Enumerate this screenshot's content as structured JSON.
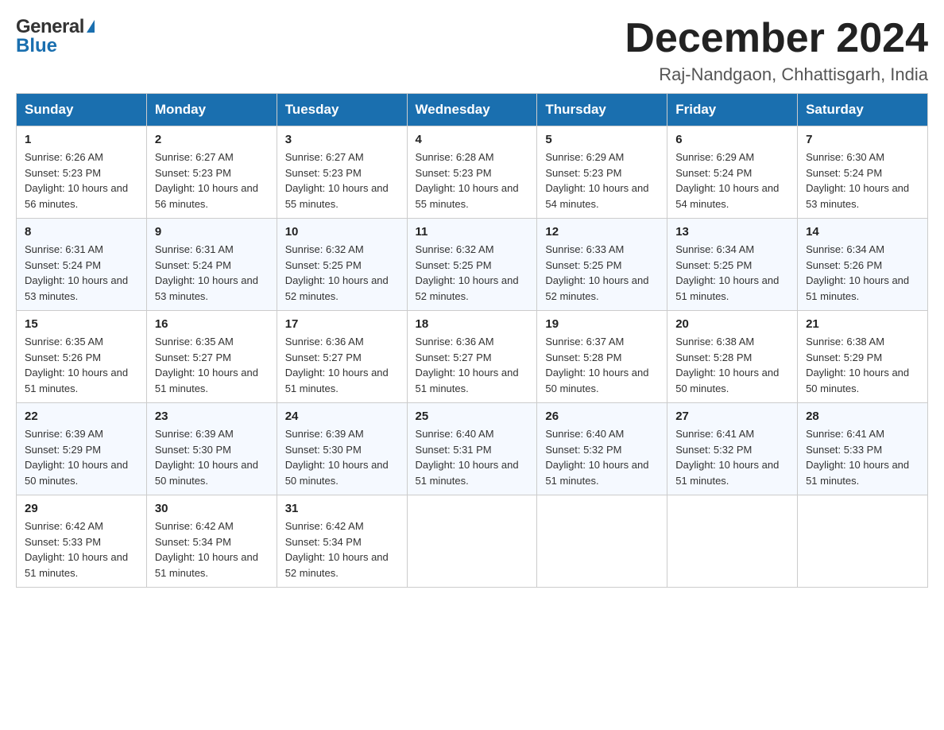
{
  "header": {
    "month_year": "December 2024",
    "location": "Raj-Nandgaon, Chhattisgarh, India",
    "logo_general": "General",
    "logo_blue": "Blue"
  },
  "days_of_week": [
    "Sunday",
    "Monday",
    "Tuesday",
    "Wednesday",
    "Thursday",
    "Friday",
    "Saturday"
  ],
  "weeks": [
    [
      {
        "day": "1",
        "sunrise": "6:26 AM",
        "sunset": "5:23 PM",
        "daylight": "10 hours and 56 minutes."
      },
      {
        "day": "2",
        "sunrise": "6:27 AM",
        "sunset": "5:23 PM",
        "daylight": "10 hours and 56 minutes."
      },
      {
        "day": "3",
        "sunrise": "6:27 AM",
        "sunset": "5:23 PM",
        "daylight": "10 hours and 55 minutes."
      },
      {
        "day": "4",
        "sunrise": "6:28 AM",
        "sunset": "5:23 PM",
        "daylight": "10 hours and 55 minutes."
      },
      {
        "day": "5",
        "sunrise": "6:29 AM",
        "sunset": "5:23 PM",
        "daylight": "10 hours and 54 minutes."
      },
      {
        "day": "6",
        "sunrise": "6:29 AM",
        "sunset": "5:24 PM",
        "daylight": "10 hours and 54 minutes."
      },
      {
        "day": "7",
        "sunrise": "6:30 AM",
        "sunset": "5:24 PM",
        "daylight": "10 hours and 53 minutes."
      }
    ],
    [
      {
        "day": "8",
        "sunrise": "6:31 AM",
        "sunset": "5:24 PM",
        "daylight": "10 hours and 53 minutes."
      },
      {
        "day": "9",
        "sunrise": "6:31 AM",
        "sunset": "5:24 PM",
        "daylight": "10 hours and 53 minutes."
      },
      {
        "day": "10",
        "sunrise": "6:32 AM",
        "sunset": "5:25 PM",
        "daylight": "10 hours and 52 minutes."
      },
      {
        "day": "11",
        "sunrise": "6:32 AM",
        "sunset": "5:25 PM",
        "daylight": "10 hours and 52 minutes."
      },
      {
        "day": "12",
        "sunrise": "6:33 AM",
        "sunset": "5:25 PM",
        "daylight": "10 hours and 52 minutes."
      },
      {
        "day": "13",
        "sunrise": "6:34 AM",
        "sunset": "5:25 PM",
        "daylight": "10 hours and 51 minutes."
      },
      {
        "day": "14",
        "sunrise": "6:34 AM",
        "sunset": "5:26 PM",
        "daylight": "10 hours and 51 minutes."
      }
    ],
    [
      {
        "day": "15",
        "sunrise": "6:35 AM",
        "sunset": "5:26 PM",
        "daylight": "10 hours and 51 minutes."
      },
      {
        "day": "16",
        "sunrise": "6:35 AM",
        "sunset": "5:27 PM",
        "daylight": "10 hours and 51 minutes."
      },
      {
        "day": "17",
        "sunrise": "6:36 AM",
        "sunset": "5:27 PM",
        "daylight": "10 hours and 51 minutes."
      },
      {
        "day": "18",
        "sunrise": "6:36 AM",
        "sunset": "5:27 PM",
        "daylight": "10 hours and 51 minutes."
      },
      {
        "day": "19",
        "sunrise": "6:37 AM",
        "sunset": "5:28 PM",
        "daylight": "10 hours and 50 minutes."
      },
      {
        "day": "20",
        "sunrise": "6:38 AM",
        "sunset": "5:28 PM",
        "daylight": "10 hours and 50 minutes."
      },
      {
        "day": "21",
        "sunrise": "6:38 AM",
        "sunset": "5:29 PM",
        "daylight": "10 hours and 50 minutes."
      }
    ],
    [
      {
        "day": "22",
        "sunrise": "6:39 AM",
        "sunset": "5:29 PM",
        "daylight": "10 hours and 50 minutes."
      },
      {
        "day": "23",
        "sunrise": "6:39 AM",
        "sunset": "5:30 PM",
        "daylight": "10 hours and 50 minutes."
      },
      {
        "day": "24",
        "sunrise": "6:39 AM",
        "sunset": "5:30 PM",
        "daylight": "10 hours and 50 minutes."
      },
      {
        "day": "25",
        "sunrise": "6:40 AM",
        "sunset": "5:31 PM",
        "daylight": "10 hours and 51 minutes."
      },
      {
        "day": "26",
        "sunrise": "6:40 AM",
        "sunset": "5:32 PM",
        "daylight": "10 hours and 51 minutes."
      },
      {
        "day": "27",
        "sunrise": "6:41 AM",
        "sunset": "5:32 PM",
        "daylight": "10 hours and 51 minutes."
      },
      {
        "day": "28",
        "sunrise": "6:41 AM",
        "sunset": "5:33 PM",
        "daylight": "10 hours and 51 minutes."
      }
    ],
    [
      {
        "day": "29",
        "sunrise": "6:42 AM",
        "sunset": "5:33 PM",
        "daylight": "10 hours and 51 minutes."
      },
      {
        "day": "30",
        "sunrise": "6:42 AM",
        "sunset": "5:34 PM",
        "daylight": "10 hours and 51 minutes."
      },
      {
        "day": "31",
        "sunrise": "6:42 AM",
        "sunset": "5:34 PM",
        "daylight": "10 hours and 52 minutes."
      },
      null,
      null,
      null,
      null
    ]
  ],
  "labels": {
    "sunrise": "Sunrise:",
    "sunset": "Sunset:",
    "daylight": "Daylight:"
  }
}
